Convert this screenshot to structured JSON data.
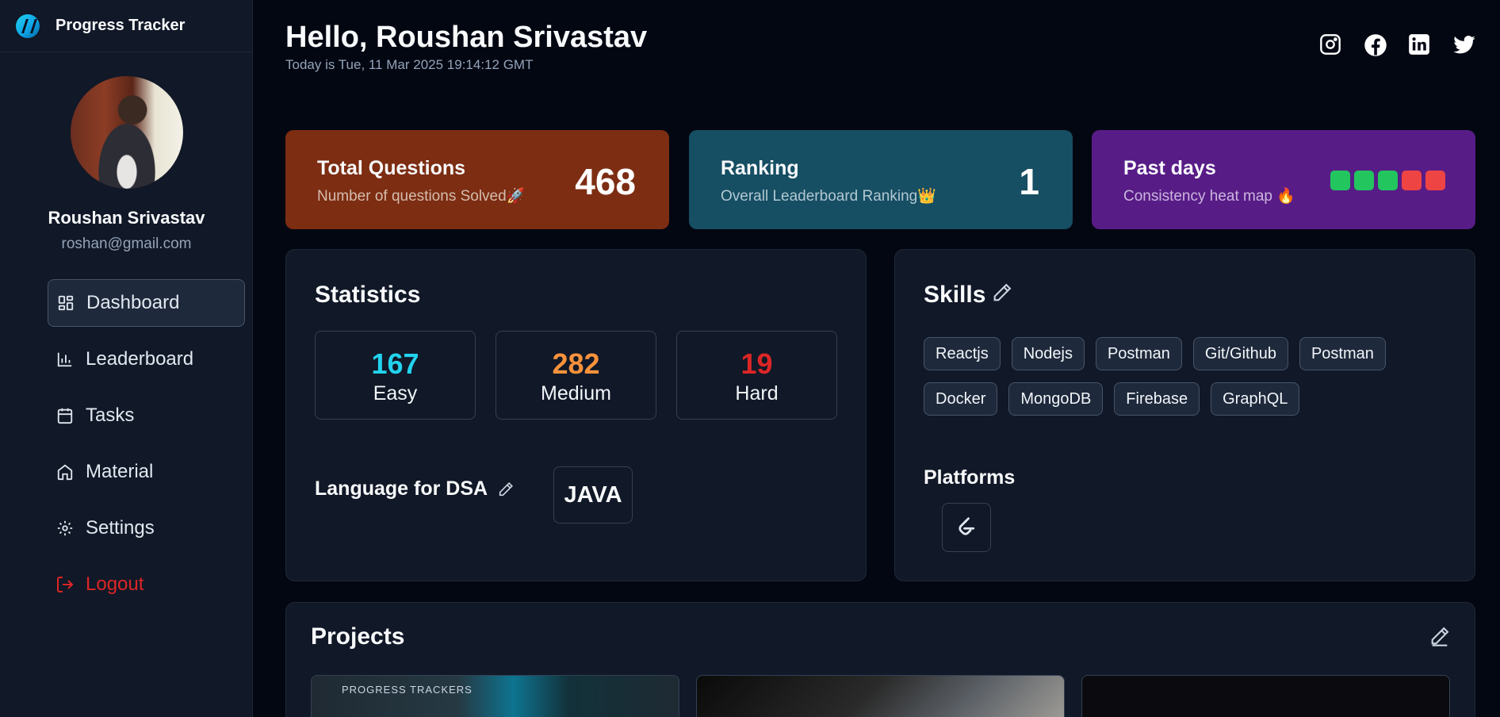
{
  "brand": {
    "name": "Progress Tracker"
  },
  "profile": {
    "name": "Roushan Srivastav",
    "email": "roshan@gmail.com"
  },
  "nav": [
    {
      "label": "Dashboard",
      "icon": "dashboard-icon"
    },
    {
      "label": "Leaderboard",
      "icon": "bar-chart-icon"
    },
    {
      "label": "Tasks",
      "icon": "calendar-icon"
    },
    {
      "label": "Material",
      "icon": "home-icon"
    },
    {
      "label": "Settings",
      "icon": "gear-icon"
    },
    {
      "label": "Logout",
      "icon": "logout-icon"
    }
  ],
  "header": {
    "greeting": "Hello, Roushan Srivastav",
    "date": "Today is Tue, 11 Mar 2025 19:14:12 GMT",
    "socials": [
      "instagram-icon",
      "facebook-icon",
      "linkedin-icon",
      "twitter-icon"
    ]
  },
  "cards": {
    "questions": {
      "title": "Total Questions",
      "subtitle": "Number of questions Solved",
      "emoji": "🚀",
      "value": "468"
    },
    "ranking": {
      "title": "Ranking",
      "subtitle": "Overall Leaderboard Ranking",
      "emoji": "👑",
      "value": "1"
    },
    "past_days": {
      "title": "Past days",
      "subtitle": "Consistency heat map",
      "emoji": "🔥",
      "heatmap": [
        "#22c55e",
        "#22c55e",
        "#22c55e",
        "#ef4444",
        "#ef4444"
      ]
    }
  },
  "statistics": {
    "title": "Statistics",
    "easy": {
      "value": "167",
      "label": "Easy",
      "color": "#22d3ee"
    },
    "medium": {
      "value": "282",
      "label": "Medium",
      "color": "#fb923c"
    },
    "hard": {
      "value": "19",
      "label": "Hard",
      "color": "#dc2626"
    },
    "language_label": "Language for DSA",
    "language": "JAVA"
  },
  "skills": {
    "title": "Skills",
    "row1": [
      "Reactjs",
      "Nodejs",
      "Postman",
      "Git/Github",
      "Postman"
    ],
    "row2": [
      "Docker",
      "MongoDB",
      "Firebase",
      "GraphQL"
    ],
    "platforms_title": "Platforms",
    "platforms": [
      "leetcode-icon"
    ]
  },
  "projects": {
    "title": "Projects",
    "thumb1_caption": "PROGRESS TRACKERS"
  },
  "colors": {
    "accent_logout": "#dc2626",
    "bg": "#030712",
    "panel": "#111827"
  }
}
